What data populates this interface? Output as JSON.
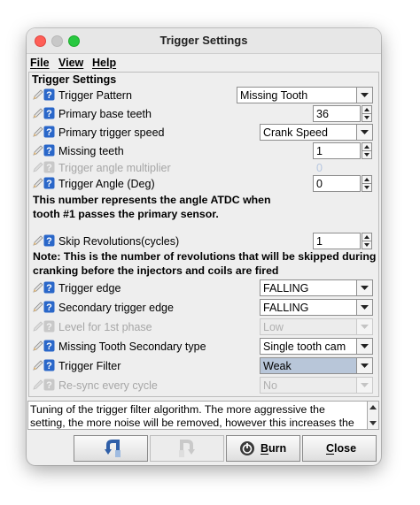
{
  "window": {
    "title": "Trigger Settings"
  },
  "menu": [
    {
      "label": "File",
      "mnemonic": "F",
      "rest": "ile"
    },
    {
      "label": "View",
      "mnemonic": "V",
      "rest": "iew"
    },
    {
      "label": "Help",
      "mnemonic": "H",
      "rest": "elp"
    }
  ],
  "panel": {
    "title": "Trigger Settings",
    "rows": {
      "trigger_pattern": {
        "label": "Trigger Pattern",
        "value": "Missing Tooth"
      },
      "primary_base_teeth": {
        "label": "Primary base teeth",
        "value": "36"
      },
      "primary_trigger_speed": {
        "label": "Primary trigger speed",
        "value": "Crank Speed"
      },
      "missing_teeth": {
        "label": "Missing teeth",
        "value": "1"
      },
      "trigger_angle_multiplier": {
        "label": "Trigger angle multiplier",
        "value": "0"
      },
      "trigger_angle": {
        "label": "Trigger Angle (Deg)",
        "value": "0"
      },
      "skip_revolutions": {
        "label": "Skip Revolutions(cycles)",
        "value": "1"
      },
      "trigger_edge": {
        "label": "Trigger edge",
        "value": "FALLING"
      },
      "secondary_trigger_edge": {
        "label": "Secondary trigger edge",
        "value": "FALLING"
      },
      "level_for_1st_phase": {
        "label": "Level for 1st phase",
        "value": "Low"
      },
      "missing_tooth_secondary_type": {
        "label": "Missing Tooth Secondary type",
        "value": "Single tooth cam"
      },
      "trigger_filter": {
        "label": "Trigger Filter",
        "value": "Weak"
      },
      "resync_every_cycle": {
        "label": "Re-sync every cycle",
        "value": "No"
      }
    },
    "notes": {
      "angle_line1": "This number represents the angle ATDC when",
      "angle_line2": "tooth #1 passes the primary sensor.",
      "skip_line1": "Note: This is the number of revolutions that will be skipped during",
      "skip_line2": "cranking before the injectors and coils are fired"
    }
  },
  "description": "Tuning of the trigger filter algorithm. The more aggressive the setting, the more noise will be removed, however this increases the chance of",
  "buttons": {
    "burn": {
      "label": "Burn",
      "mnemonic": "B",
      "rest": "urn"
    },
    "close": {
      "label": "Close",
      "mnemonic": "C",
      "rest": "lose"
    }
  },
  "icons": {
    "pen": "pencil-icon",
    "help": "help-icon",
    "undo": "undo-arrow-icon",
    "redo": "redo-arrow-icon",
    "burn": "burn-power-icon"
  },
  "colors": {
    "help_blue": "#2a67c9",
    "traffic_red": "#fe5f57",
    "traffic_green": "#28c840",
    "selection": "#b8c6d9"
  }
}
